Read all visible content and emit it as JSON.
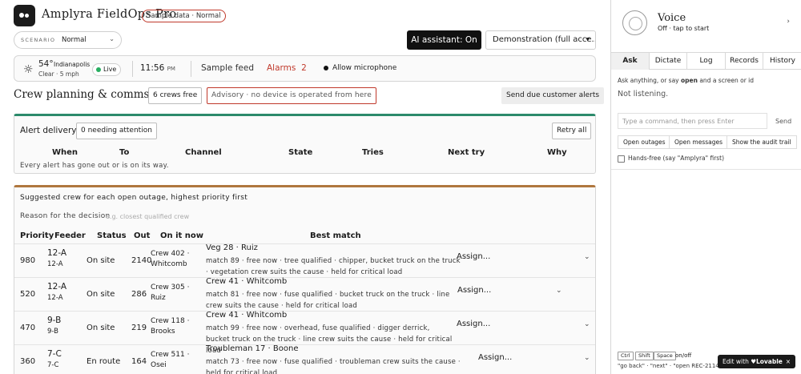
{
  "header": {
    "app_title": "Amplyra  FieldOps Pro",
    "sample_badge": "Sample data · Normal",
    "scenario_label": "SCENARIO",
    "scenario_value": "Normal",
    "ai_button": "AI assistant: On",
    "demo_select": "Demonstration (full acce..."
  },
  "status_bar": {
    "temperature": "54°",
    "city": "Indianapolis",
    "conditions": "Clear · 5 mph",
    "live_label": "Live",
    "time": "11:56",
    "ampm": "PM",
    "feed": "Sample feed",
    "alarms_label": "Alarms",
    "alarms_count": "2",
    "microphone": "Allow microphone"
  },
  "crew_section": {
    "title": "Crew planning & comms log",
    "crews_free": "6 crews free",
    "advisory": "Advisory · no device is operated from here",
    "send_alerts": "Send due customer alerts"
  },
  "alert_delivery": {
    "title": "Alert delivery",
    "needing_attention": "0 needing attention",
    "retry_all": "Retry all",
    "columns": [
      "When",
      "To",
      "Channel",
      "State",
      "Tries",
      "Next try",
      "Why"
    ],
    "empty_message": "Every alert has gone out or is on its way."
  },
  "suggested": {
    "title": "Suggested crew for each open outage, highest priority first",
    "reason_label": "Reason for the decision",
    "reason_placeholder": "e.g. closest qualified crew",
    "columns": [
      "Priority",
      "Feeder",
      "Status",
      "Out",
      "On it now",
      "Best match"
    ],
    "rows": [
      {
        "priority": "980",
        "feeder": "12-A",
        "feeder_sub": "12-A",
        "status": "On site",
        "out": "2140",
        "on_it": "Crew 402 · Whitcomb",
        "best": "Veg 28 · Ruiz",
        "detail": "match 89 · free now · tree qualified · chipper, bucket truck on the truck · vegetation crew suits the cause · held for critical load",
        "assign": "Assign..."
      },
      {
        "priority": "520",
        "feeder": "12-A",
        "feeder_sub": "12-A",
        "status": "On site",
        "out": "286",
        "on_it": "Crew 305 · Ruiz",
        "best": "Crew 41 · Whitcomb",
        "detail": "match 81 · free now · fuse qualified · bucket truck on the truck · line crew suits the cause · held for critical load",
        "assign": "Assign..."
      },
      {
        "priority": "470",
        "feeder": "9-B",
        "feeder_sub": "9-B",
        "status": "On site",
        "out": "219",
        "on_it": "Crew 118 · Brooks",
        "best": "Crew 41 · Whitcomb",
        "detail": "match 99 · free now · overhead, fuse qualified · digger derrick, bucket truck on the truck · line crew suits the cause · held for critical load",
        "assign": "Assign..."
      },
      {
        "priority": "360",
        "feeder": "7-C",
        "feeder_sub": "7-C",
        "status": "En route",
        "out": "164",
        "on_it": "Crew 511 · Osei",
        "best": "Troubleman 17 · Boone",
        "detail": "match 73 · free now · fuse qualified · troubleman crew suits the cause · held for critical load",
        "assign": "Assign..."
      }
    ]
  },
  "voice": {
    "title": "Voice",
    "subtitle": "Off · tap to start",
    "tabs": [
      "Ask",
      "Dictate",
      "Log",
      "Records",
      "History"
    ],
    "ask_hint_a": "Ask anything, or say ",
    "ask_hint_b": "open",
    "ask_hint_c": " and a screen or id",
    "not_listening": "Not listening.",
    "command_placeholder": "Type a command, then press Enter",
    "send": "Send",
    "quick_buttons": [
      "Open outages",
      "Open messages",
      "Show the audit trail"
    ],
    "hands_free": "Hands-free (say \"Amplyra\" first)",
    "keys": [
      "Ctrl",
      "Shift",
      "Space"
    ],
    "onoff": "on/off",
    "hints": "\"go back\" · \"next\" · \"open REC-2114\""
  },
  "lovable": {
    "edit_with": "Edit with",
    "brand": "Lovable",
    "close": "×"
  }
}
